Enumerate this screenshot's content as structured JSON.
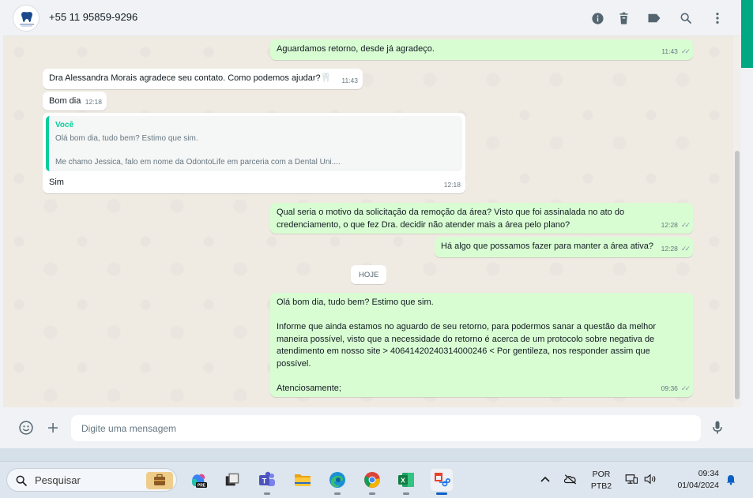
{
  "header": {
    "contact_name": "+55 11 95859-9296",
    "icons": [
      "info-icon",
      "trash-icon",
      "label-icon",
      "search-icon",
      "menu-icon"
    ]
  },
  "messages": [
    {
      "direction": "out",
      "text": "Aguardamos retorno, desde já agradeço.",
      "time": "11:43",
      "status": "read"
    },
    {
      "direction": "in",
      "text": "Dra Alessandra Morais agradece seu contato. Como podemos ajudar?🦷",
      "time": "11:43"
    },
    {
      "direction": "in",
      "text": "Bom dia",
      "time": "12:18"
    },
    {
      "direction": "in",
      "quoted_author": "Você",
      "quoted_text": "Olá bom dia, tudo bem? Estimo que sim.\n\nMe chamo Jessica, falo em nome da OdontoLife em parceria com a Dental Uni....",
      "text": "Sim",
      "time": "12:18"
    },
    {
      "direction": "out",
      "text": "Qual seria o motivo da solicitação da remoção da área? Visto que foi assinalada no ato do\ncredenciamento, o que fez Dra. decidir não atender mais a área pelo plano?",
      "time": "12:28",
      "status": "read"
    },
    {
      "direction": "out",
      "text": "Há algo que possamos fazer para manter a área ativa?",
      "time": "12:28",
      "status": "read"
    },
    {
      "direction": "out",
      "text": "Olá bom dia, tudo bem? Estimo que sim.\n\nInforme que ainda estamos no aguardo de seu retorno, para podermos sanar a questão da melhor\nmaneira possível, visto que a necessidade do retorno é acerca de um protocolo sobre negativa de\natendimento em nosso site > 40641420240314000246 < Por gentileza, nos responder assim que\npossível.\n\nAtenciosamente;",
      "time": "09:36",
      "status": "read"
    }
  ],
  "date_separator": "HOJE",
  "footer": {
    "input_placeholder": "Digite uma mensagem",
    "icons": [
      "emoji-icon",
      "attach-plus-icon",
      "microphone-icon"
    ]
  },
  "taskbar": {
    "search_label": "Pesquisar",
    "apps": [
      "copilot-pre",
      "task-view",
      "teams",
      "file-explorer",
      "edge",
      "chrome",
      "excel",
      "snipping-tool"
    ],
    "language_line1": "POR",
    "language_line2": "PTB2",
    "time": "09:34",
    "date": "01/04/2024"
  },
  "colors": {
    "outgoing_bubble": "#d9fdd3",
    "incoming_bubble": "#ffffff",
    "accent": "#00a884",
    "quote_accent": "#06cf9c",
    "chat_background": "#efeae2"
  }
}
